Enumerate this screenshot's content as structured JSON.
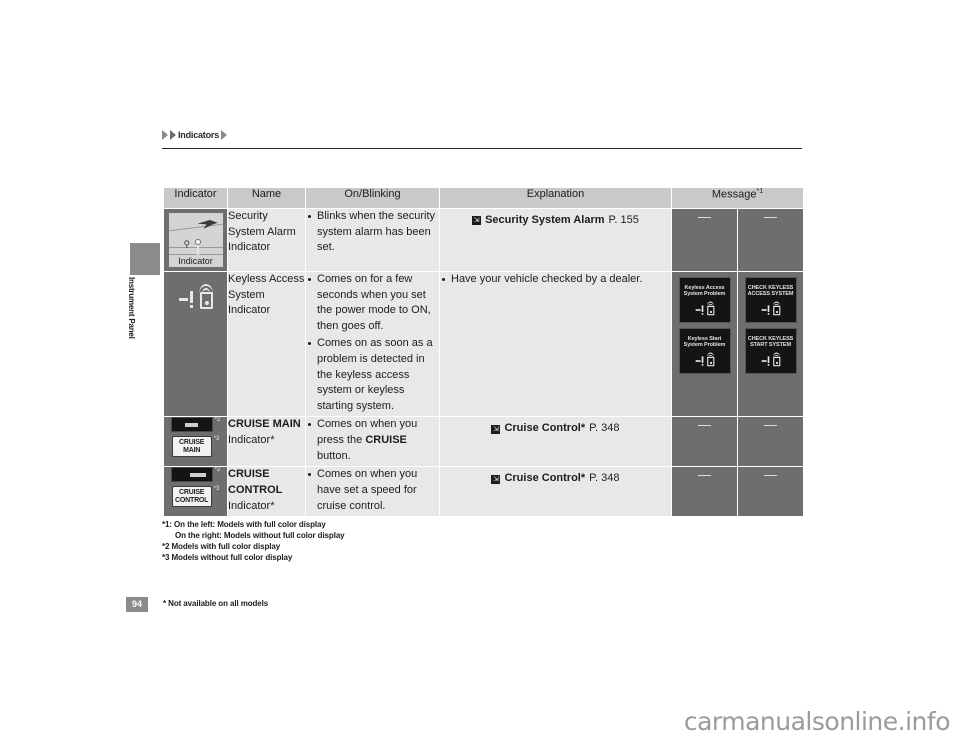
{
  "breadcrumb": {
    "text": "Indicators"
  },
  "sidebar": {
    "tab_label": "Instrument Panel"
  },
  "table": {
    "headers": {
      "indicator": "Indicator",
      "name": "Name",
      "onblinking": "On/Blinking",
      "explanation": "Explanation",
      "message": "Message",
      "message_sup": "*1"
    },
    "rows": [
      {
        "indicator_caption": "Indicator",
        "name": "Security System Alarm Indicator",
        "onblinking": [
          "Blinks when the security system alarm has been set."
        ],
        "explanation_ref": {
          "icon": "page-reference-icon",
          "title": "Security System Alarm",
          "page": "P. 155"
        },
        "message_left": "—",
        "message_right": "—"
      },
      {
        "name": "Keyless Access System Indicator",
        "onblinking": [
          "Comes on for a few seconds when you set the power mode to ON, then goes off.",
          "Comes on as soon as a problem is detected in the keyless access system or keyless starting system."
        ],
        "explanation_bullets": [
          "Have your vehicle checked by a dealer."
        ],
        "message_left_screens": [
          "Keyless Access System Problem",
          "Keyless Start System Problem"
        ],
        "message_right_screens": [
          "CHECK KEYLESS ACCESS SYSTEM",
          "CHECK KEYLESS START SYSTEM"
        ]
      },
      {
        "name_bold": "CRUISE MAIN",
        "name_sub": "Indicator*",
        "badge_text": "CRUISE MAIN",
        "sup_screen": "*2",
        "sup_badge": "*3",
        "onblinking_pre": "Comes on when you press the ",
        "onblinking_bold": "CRUISE",
        "onblinking_post": " button.",
        "explanation_ref": {
          "icon": "page-reference-icon",
          "title": "Cruise Control*",
          "page": "P. 348"
        },
        "message_left": "—",
        "message_right": "—"
      },
      {
        "name_bold": "CRUISE CONTROL",
        "name_sub": "Indicator*",
        "badge_text": "CRUISE CONTROL",
        "sup_screen": "*2",
        "sup_badge": "*3",
        "onblinking": [
          "Comes on when you have set a speed for cruise control."
        ],
        "explanation_ref": {
          "icon": "page-reference-icon",
          "title": "Cruise Control*",
          "page": "P. 348"
        },
        "message_left": "—",
        "message_right": "—"
      }
    ]
  },
  "footnotes": [
    "*1: On the left: Models with full color display",
    "On the right: Models without full color display",
    "*2 Models with full color display",
    "*3 Models without full color display"
  ],
  "bottom": {
    "page_number": "94",
    "note": "* Not available on all models"
  },
  "watermark": {
    "text": "carmanualsonline.info"
  },
  "colors": {
    "header_gray": "#c9c9c9",
    "cell_gray": "#e8e8e8",
    "dark_gray": "#6e6e6e",
    "screen_black": "#141414"
  }
}
